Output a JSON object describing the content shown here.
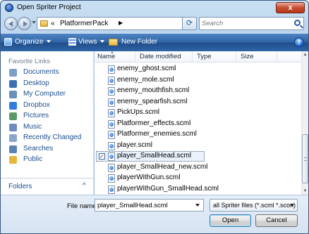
{
  "window": {
    "title": "Open Spriter Project",
    "close_label": "x"
  },
  "address": {
    "separator": "«",
    "crumb": "PlatformerPack",
    "crumb_arrow": "▶"
  },
  "search": {
    "placeholder": "Search"
  },
  "toolbar": {
    "organize": "Organize",
    "views": "Views",
    "new_folder": "New Folder",
    "help": "?"
  },
  "nav": {
    "header": "Favorite Links",
    "items": [
      {
        "label": "Documents",
        "icon": "documents-icon",
        "color": "#7aa0c8"
      },
      {
        "label": "Desktop",
        "icon": "desktop-icon",
        "color": "#3b6fb0"
      },
      {
        "label": "My Computer",
        "icon": "computer-icon",
        "color": "#6a8fb8"
      },
      {
        "label": "Dropbox",
        "icon": "dropbox-icon",
        "color": "#2d7de0"
      },
      {
        "label": "Pictures",
        "icon": "pictures-icon",
        "color": "#5a9a6a"
      },
      {
        "label": "Music",
        "icon": "music-icon",
        "color": "#6c8cc0"
      },
      {
        "label": "Recently Changed",
        "icon": "recent-icon",
        "color": "#8aa6c8"
      },
      {
        "label": "Searches",
        "icon": "searches-icon",
        "color": "#5a82b4"
      },
      {
        "label": "Public",
        "icon": "public-folder-icon",
        "color": "#e6b53c"
      }
    ],
    "folders_label": "Folders",
    "folders_chevron": "^"
  },
  "columns": {
    "name": "Name",
    "date": "Date modified",
    "type": "Type",
    "size": "Size"
  },
  "files": [
    "enemy_ghost.scml",
    "enemy_mole.scml",
    "enemy_mouthfish.scml",
    "enemy_spearfish.scml",
    "PickUps.scml",
    "Platformer_effects.scml",
    "Platformer_enemies.scml",
    "player.scml",
    "player_SmallHead.scml",
    "player_SmallHead_new.scml",
    "playerWithGun.scml",
    "playerWithGun_SmallHead.scml"
  ],
  "selected_index": 8,
  "checkmark": "✓",
  "scroll": {
    "up": "▲",
    "down": "▼"
  },
  "bottom": {
    "filename_label": "File name:",
    "filename_value": "player_SmallHead.scml",
    "filetype": "all Spriter files (*.scml *.scon)",
    "open": "Open",
    "cancel": "Cancel"
  }
}
